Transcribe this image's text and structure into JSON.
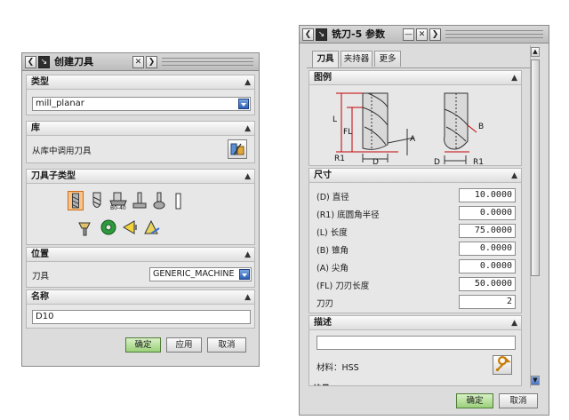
{
  "left_dialog": {
    "title": "创建刀具",
    "type_section": {
      "header": "类型",
      "selected_value": "mill_planar"
    },
    "library_section": {
      "header": "库",
      "label": "从库中调用刀具"
    },
    "subtype_section": {
      "header": "刀具子类型"
    },
    "location_section": {
      "header": "位置",
      "tool_label": "刀具",
      "tool_value": "GENERIC_MACHINE"
    },
    "name_section": {
      "header": "名称",
      "name_value": "D10"
    },
    "buttons": {
      "ok": "确定",
      "apply": "应用",
      "cancel": "取消"
    }
  },
  "right_dialog": {
    "title": "铣刀-5 参数",
    "tabs": [
      {
        "label": "刀具",
        "active": true
      },
      {
        "label": "夹持器",
        "active": false
      },
      {
        "label": "更多",
        "active": false
      }
    ],
    "legend_section": {
      "header": "图例",
      "diagram_labels": {
        "L": "L",
        "FL": "FL",
        "R1_left": "R1",
        "D_left": "D",
        "A": "A",
        "B": "B",
        "D_right": "D",
        "R1_right": "R1"
      }
    },
    "dimensions_section": {
      "header": "尺寸",
      "params": [
        {
          "label": "(D) 直径",
          "value": "10.0000"
        },
        {
          "label": "(R1) 底圆角半径",
          "value": "0.0000"
        },
        {
          "label": "(L) 长度",
          "value": "75.0000"
        },
        {
          "label": "(B) 锥角",
          "value": "0.0000"
        },
        {
          "label": "(A) 尖角",
          "value": "0.0000"
        },
        {
          "label": "(FL) 刀刃长度",
          "value": "50.0000"
        },
        {
          "label": "刀刃",
          "value": "2"
        }
      ]
    },
    "description_section": {
      "header": "描述",
      "description_value": "",
      "material_label": "材料：HSS"
    },
    "next_header_partial": "编号",
    "buttons": {
      "ok": "确定",
      "cancel": "取消"
    }
  },
  "colors": {
    "ok_button": "#9bd17a",
    "dropdown_arrow": "#2d5fb5",
    "dimension_red": "#c00000"
  }
}
